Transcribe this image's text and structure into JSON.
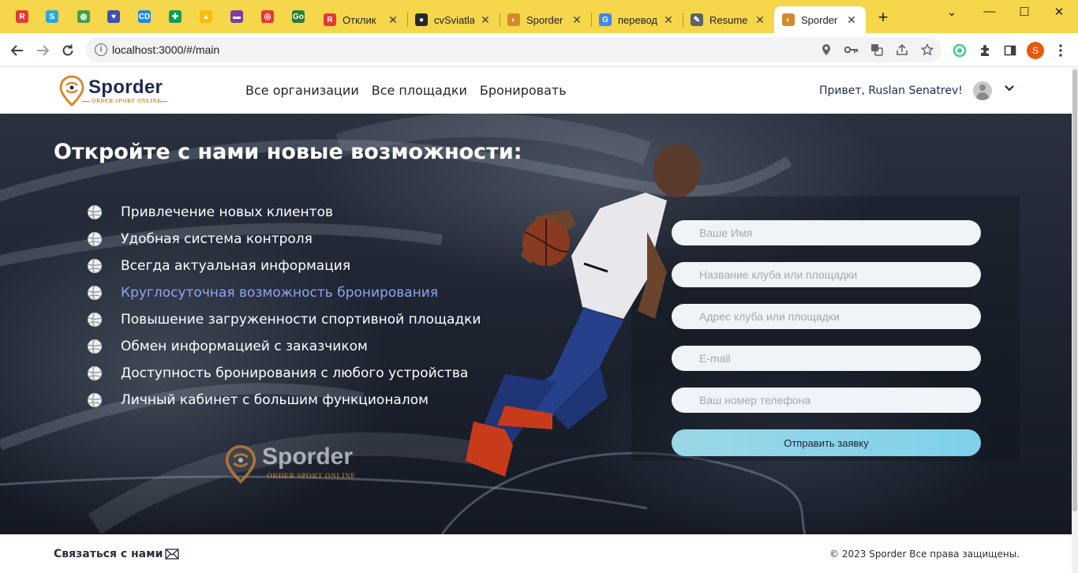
{
  "browser": {
    "pinned_tabs": [
      {
        "icon": "r-icon",
        "glyph": "R",
        "color": "#e53935"
      },
      {
        "icon": "s-icon",
        "glyph": "S",
        "color": "#29a8e0"
      },
      {
        "icon": "globe-green-icon",
        "glyph": "◍",
        "color": "#43a047"
      },
      {
        "icon": "shield-icon",
        "glyph": "♥",
        "color": "#3f51b5"
      },
      {
        "icon": "cd-icon",
        "glyph": "CD",
        "color": "#1e88e5"
      },
      {
        "icon": "sheets-icon",
        "glyph": "✚",
        "color": "#0f9d58"
      },
      {
        "icon": "drive-icon",
        "glyph": "▲",
        "color": "#fbbc04"
      },
      {
        "icon": "purple-app-icon",
        "glyph": "▬",
        "color": "#7b3fa0"
      },
      {
        "icon": "red-circle-icon",
        "glyph": "◎",
        "color": "#e53935"
      },
      {
        "icon": "go-icon",
        "glyph": "Go",
        "color": "#2e7d32"
      }
    ],
    "tabs": [
      {
        "title": "Отклик",
        "icon": "r-icon",
        "glyph": "R",
        "color": "#e53935",
        "active": false
      },
      {
        "title": "cvSviatlan",
        "icon": "github-icon",
        "glyph": "●",
        "color": "#24292e",
        "active": false
      },
      {
        "title": "Sporder",
        "icon": "sporder-icon",
        "glyph": "◐",
        "color": "#d48a2c",
        "active": false
      },
      {
        "title": "переводч",
        "icon": "google-icon",
        "glyph": "G",
        "color": "#4285f4",
        "active": false
      },
      {
        "title": "Resume",
        "icon": "edit-icon",
        "glyph": "✎",
        "color": "#5f6368",
        "active": false
      },
      {
        "title": "Sporder",
        "icon": "sporder-icon",
        "glyph": "◐",
        "color": "#d48a2c",
        "active": true
      }
    ],
    "close_glyph": "✕",
    "new_tab_glyph": "+",
    "url": "localhost:3000/#/main",
    "profile_initial": "S",
    "window_controls": [
      "⌄",
      "—",
      "☐",
      "✕"
    ]
  },
  "header": {
    "logo_word": "Sporder",
    "logo_sub": "ORDER SPORT ONLINE",
    "nav": [
      "Все организации",
      "Все площадки",
      "Бронировать"
    ],
    "greeting": "Привет, Ruslan Senatrev!"
  },
  "hero": {
    "title": "Откройте с нами новые возможности:",
    "features": [
      {
        "text": "Привлечение новых клиентов",
        "highlight": false
      },
      {
        "text": "Удобная система контроля",
        "highlight": false
      },
      {
        "text": "Всегда актуальная информация",
        "highlight": false
      },
      {
        "text": "Круглосуточная возможность бронирования",
        "highlight": true
      },
      {
        "text": "Повышение загруженности спортивной площадки",
        "highlight": false
      },
      {
        "text": "Обмен информацией с заказчиком",
        "highlight": false
      },
      {
        "text": "Доступность бронирования с любого устройства",
        "highlight": false
      },
      {
        "text": "Личный кабинет с большим функционалом",
        "highlight": false
      }
    ],
    "logo_word": "Sporder",
    "logo_sub": "ORDER SPORT ONLINE"
  },
  "form": {
    "name_placeholder": "Ваше Имя",
    "club_placeholder": "Название клуба или площадки",
    "address_placeholder": "Адрес клуба или площадки",
    "email_placeholder": "E-mail",
    "phone_placeholder": "Ваш номер телефона",
    "submit_label": "Отправить заявку"
  },
  "footer": {
    "contact": "Связаться с нами",
    "copyright": "© 2023 Sporder  Все права защищены."
  },
  "colors": {
    "browser_frame": "#f6d64a",
    "brand_navy": "#1e2a52",
    "brand_orange": "#d48a2c",
    "highlight": "#8fa3f5",
    "submit": "#7fd0ea"
  }
}
